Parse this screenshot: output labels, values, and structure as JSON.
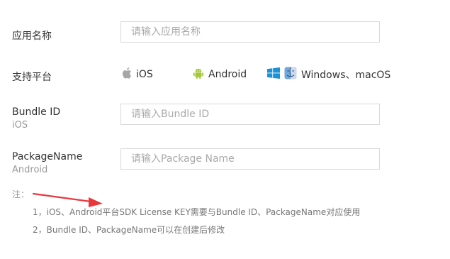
{
  "form": {
    "app_name": {
      "label": "应用名称",
      "placeholder": "请输入应用名称"
    },
    "platforms": {
      "label": "支持平台",
      "ios": "iOS",
      "android": "Android",
      "windows_macos": "Windows、macOS"
    },
    "bundle_id": {
      "label": "Bundle ID",
      "sublabel": "iOS",
      "placeholder": "请输入Bundle ID"
    },
    "package_name": {
      "label": "PackageName",
      "sublabel": "Android",
      "placeholder": "请输入Package Name"
    }
  },
  "notes": {
    "title": "注：",
    "items": [
      "1，iOS、Android平台SDK License KEY需要与Bundle ID、PackageName对应使用",
      "2，Bundle ID、PackageName可以在创建后修改"
    ]
  },
  "colors": {
    "arrow": "#e8383d",
    "android_green": "#a4c639",
    "apple_gray": "#a6a6a6",
    "windows_blue": "#1e90d8"
  }
}
